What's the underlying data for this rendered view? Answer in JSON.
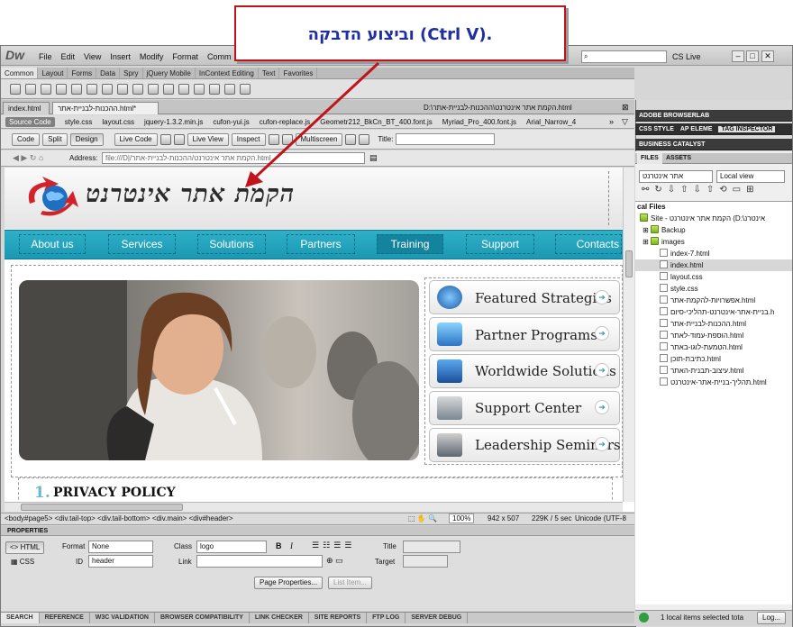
{
  "callout": {
    "text": "וביצוע הדבקה (Ctrl V)."
  },
  "app": {
    "logo": "Dw",
    "menus": [
      "File",
      "Edit",
      "View",
      "Insert",
      "Modify",
      "Format",
      "Comm"
    ],
    "cs_live": "CS Live",
    "insert_tabs": [
      "Common",
      "Layout",
      "Forms",
      "Data",
      "Spry",
      "jQuery Mobile",
      "InContext Editing",
      "Text",
      "Favorites"
    ]
  },
  "documents": {
    "tabs": [
      "index.html",
      "ההכנות-לבניית-אתר.html*"
    ],
    "path": "D:\\הקמת אתר אינטרנט\\ההכנות-לבניית-אתר.html",
    "related_files": [
      "Source Code",
      "style.css",
      "layout.css",
      "jquery-1.3.2.min.js",
      "cufon-yui.js",
      "cufon-replace.js",
      "Geometr212_BkCn_BT_400.font.js",
      "Myriad_Pro_400.font.js",
      "Arial_Narrow_4"
    ]
  },
  "document_toolbar": {
    "code": "Code",
    "split": "Split",
    "design": "Design",
    "live_code": "Live Code",
    "live_view": "Live View",
    "inspect": "Inspect",
    "multiscreen": "Multiscreen",
    "title_label": "Title:"
  },
  "address": {
    "label": "Address:",
    "value": "file:///D|/הקמת אתר אינטרנט/ההכנות-לבניית-אתר.html"
  },
  "site": {
    "logo_text": "הקמת אתר אינטרנט",
    "nav": [
      "About us",
      "Services",
      "Solutions",
      "Partners",
      "Training",
      "Support",
      "Contacts"
    ],
    "features": [
      "Featured Strategies",
      "Partner Programs",
      "Worldwide Solutions",
      "Support Center",
      "Leadership Seminars"
    ],
    "privacy_number": "1.",
    "privacy_title": "PRIVACY POLICY"
  },
  "status": {
    "tag_path": "<body#page5> <div.tail-top> <div.tail-bottom> <div.main> <div#header>",
    "zoom": "100%",
    "size": "942 x 507",
    "filesize": "229K / 5 sec",
    "encoding": "Unicode (UTF-8"
  },
  "properties": {
    "header": "PROPERTIES",
    "html": "HTML",
    "css": "CSS",
    "format_label": "Format",
    "format_value": "None",
    "class_label": "Class",
    "class_value": "logo",
    "id_label": "ID",
    "id_value": "header",
    "link_label": "Link",
    "title_label": "Title",
    "target_label": "Target",
    "bold": "B",
    "italic": "I",
    "page_properties": "Page Properties...",
    "list_item": "List Item..."
  },
  "bottom_tabs": [
    "SEARCH",
    "REFERENCE",
    "W3C VALIDATION",
    "BROWSER COMPATIBILITY",
    "LINK CHECKER",
    "SITE REPORTS",
    "FTP LOG",
    "SERVER DEBUG"
  ],
  "panels": {
    "browserlab": "ADOBE BROWSERLAB",
    "css_styles": "CSS STYLE",
    "ap_elements": "AP ELEME",
    "tag_inspector": "TAG INSPECTOR",
    "business_catalyst": "BUSINESS CATALYST",
    "files_tab": "FILES",
    "assets_tab": "ASSETS",
    "site_select": "אתר אינטרנט",
    "view_select": "Local view",
    "local_files": "cal Files",
    "site_root": "Site - הקמת אתר אינטרנט (D:\\אינטרנ",
    "folders": [
      "Backup",
      "images"
    ],
    "files": [
      "index-7.html",
      "index.html",
      "layout.css",
      "style.css",
      "אפשרויות-להקמת-אתר.html",
      "בניית-אתר-אינטרנט-תהליכי-סיום.h",
      "ההכנות-לבניית-אתר.html",
      "הוספת-עמוד-לאתר.html",
      "הטמעת-לוגו-באתר.html",
      "כתיבת-תוכן.html",
      "עיצוב-תבנית-האתר.html",
      "תהליך-בניית-אתר-אינטרנט.html"
    ],
    "status": "1 local items selected tota",
    "log_button": "Log..."
  }
}
